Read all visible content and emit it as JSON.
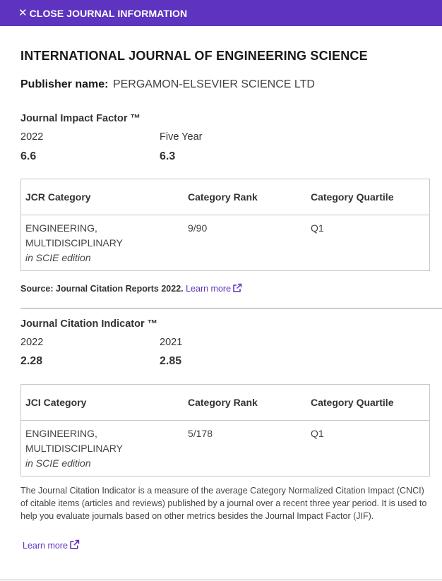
{
  "header": {
    "close_symbol": "✕",
    "close_label": "CLOSE JOURNAL INFORMATION"
  },
  "journal": {
    "title": "INTERNATIONAL JOURNAL OF ENGINEERING SCIENCE",
    "publisher_label": "Publisher name:",
    "publisher_value": "PERGAMON-ELSEVIER SCIENCE LTD"
  },
  "jif": {
    "title": "Journal Impact Factor ™",
    "col1_label": "2022",
    "col1_value": "6.6",
    "col2_label": "Five Year",
    "col2_value": "6.3",
    "table": {
      "headers": [
        "JCR Category",
        "Category Rank",
        "Category Quartile"
      ],
      "rows": [
        {
          "category_line1": "ENGINEERING,",
          "category_line2": "MULTIDISCIPLINARY",
          "edition": "in SCIE edition",
          "rank": "9/90",
          "quartile": "Q1"
        }
      ]
    },
    "source_label": "Source: Journal Citation Reports",
    "source_year": "2022.",
    "learn_more": "Learn more"
  },
  "jci": {
    "title": "Journal Citation Indicator ™",
    "col1_label": "2022",
    "col1_value": "2.28",
    "col2_label": "2021",
    "col2_value": "2.85",
    "table": {
      "headers": [
        "JCI Category",
        "Category Rank",
        "Category Quartile"
      ],
      "rows": [
        {
          "category_line1": "ENGINEERING,",
          "category_line2": "MULTIDISCIPLINARY",
          "edition": "in SCIE edition",
          "rank": "5/178",
          "quartile": "Q1"
        }
      ]
    },
    "description": "The Journal Citation Indicator is a measure of the average Category Normalized Citation Impact (CNCI) of citable items (articles and reviews) published by a journal over a recent three year period. It is used to help you evaluate journals based on other metrics besides the Journal Impact Factor (JIF).",
    "learn_more": "Learn more"
  },
  "colors": {
    "accent": "#5e33bf",
    "text": "#333333",
    "border": "#c8c8c8"
  },
  "icons": {
    "close": "close-icon",
    "external_link": "external-link-icon"
  }
}
